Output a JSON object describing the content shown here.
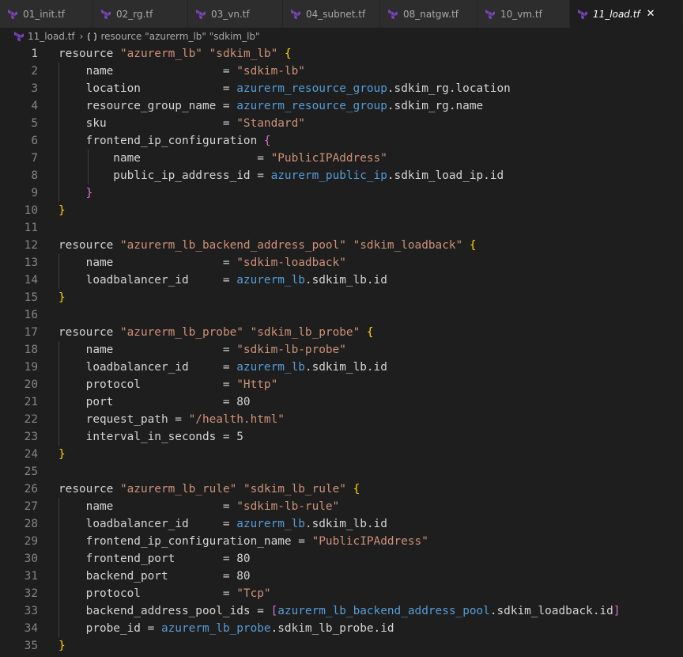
{
  "tabs": [
    {
      "label": "01_init.tf",
      "active": false,
      "width": 118
    },
    {
      "label": "02_rg.tf",
      "active": false,
      "width": 120
    },
    {
      "label": "03_vn.tf",
      "active": false,
      "width": 120
    },
    {
      "label": "04_subnet.tf",
      "active": false,
      "width": 123
    },
    {
      "label": "08_natgw.tf",
      "active": false,
      "width": 123
    },
    {
      "label": "10_vm.tf",
      "active": false,
      "width": 117
    },
    {
      "label": "11_load.tf",
      "active": true,
      "width": 143
    }
  ],
  "tab_close_glyph": "✕",
  "breadcrumb": {
    "file": "11_load.tf",
    "separator": "›",
    "symbol": "resource \"azurerm_lb\" \"sdkim_lb\""
  },
  "colors": {
    "terraform_icon": "#7b42bc",
    "symbol_icon": "#c8c8c8",
    "string": "#ce9178",
    "reference": "#569cd6",
    "bracket_level1": "#ffd700",
    "bracket_level2": "#da70d6",
    "bracket_level3": "#179fff",
    "text": "#d4d4d4"
  },
  "current_line": 1,
  "code_lines": [
    [
      {
        "t": "resource "
      },
      {
        "t": "\"azurerm_lb\"",
        "c": "str"
      },
      {
        "t": " "
      },
      {
        "t": "\"sdkim_lb\"",
        "c": "str"
      },
      {
        "t": " "
      },
      {
        "t": "{",
        "c": "br-y"
      }
    ],
    [
      {
        "t": "    name                = "
      },
      {
        "t": "\"sdkim-lb\"",
        "c": "str"
      }
    ],
    [
      {
        "t": "    location            = "
      },
      {
        "t": "azurerm_resource_group",
        "c": "ref"
      },
      {
        "t": ".sdkim_rg.location"
      }
    ],
    [
      {
        "t": "    resource_group_name = "
      },
      {
        "t": "azurerm_resource_group",
        "c": "ref"
      },
      {
        "t": ".sdkim_rg.name"
      }
    ],
    [
      {
        "t": "    sku                 = "
      },
      {
        "t": "\"Standard\"",
        "c": "str"
      }
    ],
    [
      {
        "t": "    frontend_ip_configuration "
      },
      {
        "t": "{",
        "c": "br-p"
      }
    ],
    [
      {
        "t": "        name                 = "
      },
      {
        "t": "\"PublicIPAddress\"",
        "c": "str"
      }
    ],
    [
      {
        "t": "        public_ip_address_id = "
      },
      {
        "t": "azurerm_public_ip",
        "c": "ref"
      },
      {
        "t": ".sdkim_load_ip.id"
      }
    ],
    [
      {
        "t": "    "
      },
      {
        "t": "}",
        "c": "br-p"
      }
    ],
    [
      {
        "t": "}",
        "c": "br-y"
      }
    ],
    [],
    [
      {
        "t": "resource "
      },
      {
        "t": "\"azurerm_lb_backend_address_pool\"",
        "c": "str"
      },
      {
        "t": " "
      },
      {
        "t": "\"sdkim_loadback\"",
        "c": "str"
      },
      {
        "t": " "
      },
      {
        "t": "{",
        "c": "br-y"
      }
    ],
    [
      {
        "t": "    name                = "
      },
      {
        "t": "\"sdkim-loadback\"",
        "c": "str"
      }
    ],
    [
      {
        "t": "    loadbalancer_id     = "
      },
      {
        "t": "azurerm_lb",
        "c": "ref"
      },
      {
        "t": ".sdkim_lb.id"
      }
    ],
    [
      {
        "t": "}",
        "c": "br-y"
      }
    ],
    [],
    [
      {
        "t": "resource "
      },
      {
        "t": "\"azurerm_lb_probe\"",
        "c": "str"
      },
      {
        "t": " "
      },
      {
        "t": "\"sdkim_lb_probe\"",
        "c": "str"
      },
      {
        "t": " "
      },
      {
        "t": "{",
        "c": "br-y"
      }
    ],
    [
      {
        "t": "    name                = "
      },
      {
        "t": "\"sdkim-lb-probe\"",
        "c": "str"
      }
    ],
    [
      {
        "t": "    loadbalancer_id     = "
      },
      {
        "t": "azurerm_lb",
        "c": "ref"
      },
      {
        "t": ".sdkim_lb.id"
      }
    ],
    [
      {
        "t": "    protocol            = "
      },
      {
        "t": "\"Http\"",
        "c": "str"
      }
    ],
    [
      {
        "t": "    port                = 80"
      }
    ],
    [
      {
        "t": "    request_path = "
      },
      {
        "t": "\"/health.html\"",
        "c": "str"
      }
    ],
    [
      {
        "t": "    interval_in_seconds = 5"
      }
    ],
    [
      {
        "t": "}",
        "c": "br-y"
      }
    ],
    [],
    [
      {
        "t": "resource "
      },
      {
        "t": "\"azurerm_lb_rule\"",
        "c": "str"
      },
      {
        "t": " "
      },
      {
        "t": "\"sdkim_lb_rule\"",
        "c": "str"
      },
      {
        "t": " "
      },
      {
        "t": "{",
        "c": "br-y"
      }
    ],
    [
      {
        "t": "    name                = "
      },
      {
        "t": "\"sdkim-lb-rule\"",
        "c": "str"
      }
    ],
    [
      {
        "t": "    loadbalancer_id     = "
      },
      {
        "t": "azurerm_lb",
        "c": "ref"
      },
      {
        "t": ".sdkim_lb.id"
      }
    ],
    [
      {
        "t": "    frontend_ip_configuration_name = "
      },
      {
        "t": "\"PublicIPAddress\"",
        "c": "str"
      }
    ],
    [
      {
        "t": "    frontend_port       = 80"
      }
    ],
    [
      {
        "t": "    backend_port        = 80"
      }
    ],
    [
      {
        "t": "    protocol            = "
      },
      {
        "t": "\"Tcp\"",
        "c": "str"
      }
    ],
    [
      {
        "t": "    backend_address_pool_ids = "
      },
      {
        "t": "[",
        "c": "br-p"
      },
      {
        "t": "azurerm_lb_backend_address_pool",
        "c": "ref"
      },
      {
        "t": ".sdkim_loadback.id"
      },
      {
        "t": "]",
        "c": "br-p"
      }
    ],
    [
      {
        "t": "    probe_id = "
      },
      {
        "t": "azurerm_lb_probe",
        "c": "ref"
      },
      {
        "t": ".sdkim_lb_probe.id"
      }
    ],
    [
      {
        "t": "}",
        "c": "br-y"
      }
    ]
  ]
}
